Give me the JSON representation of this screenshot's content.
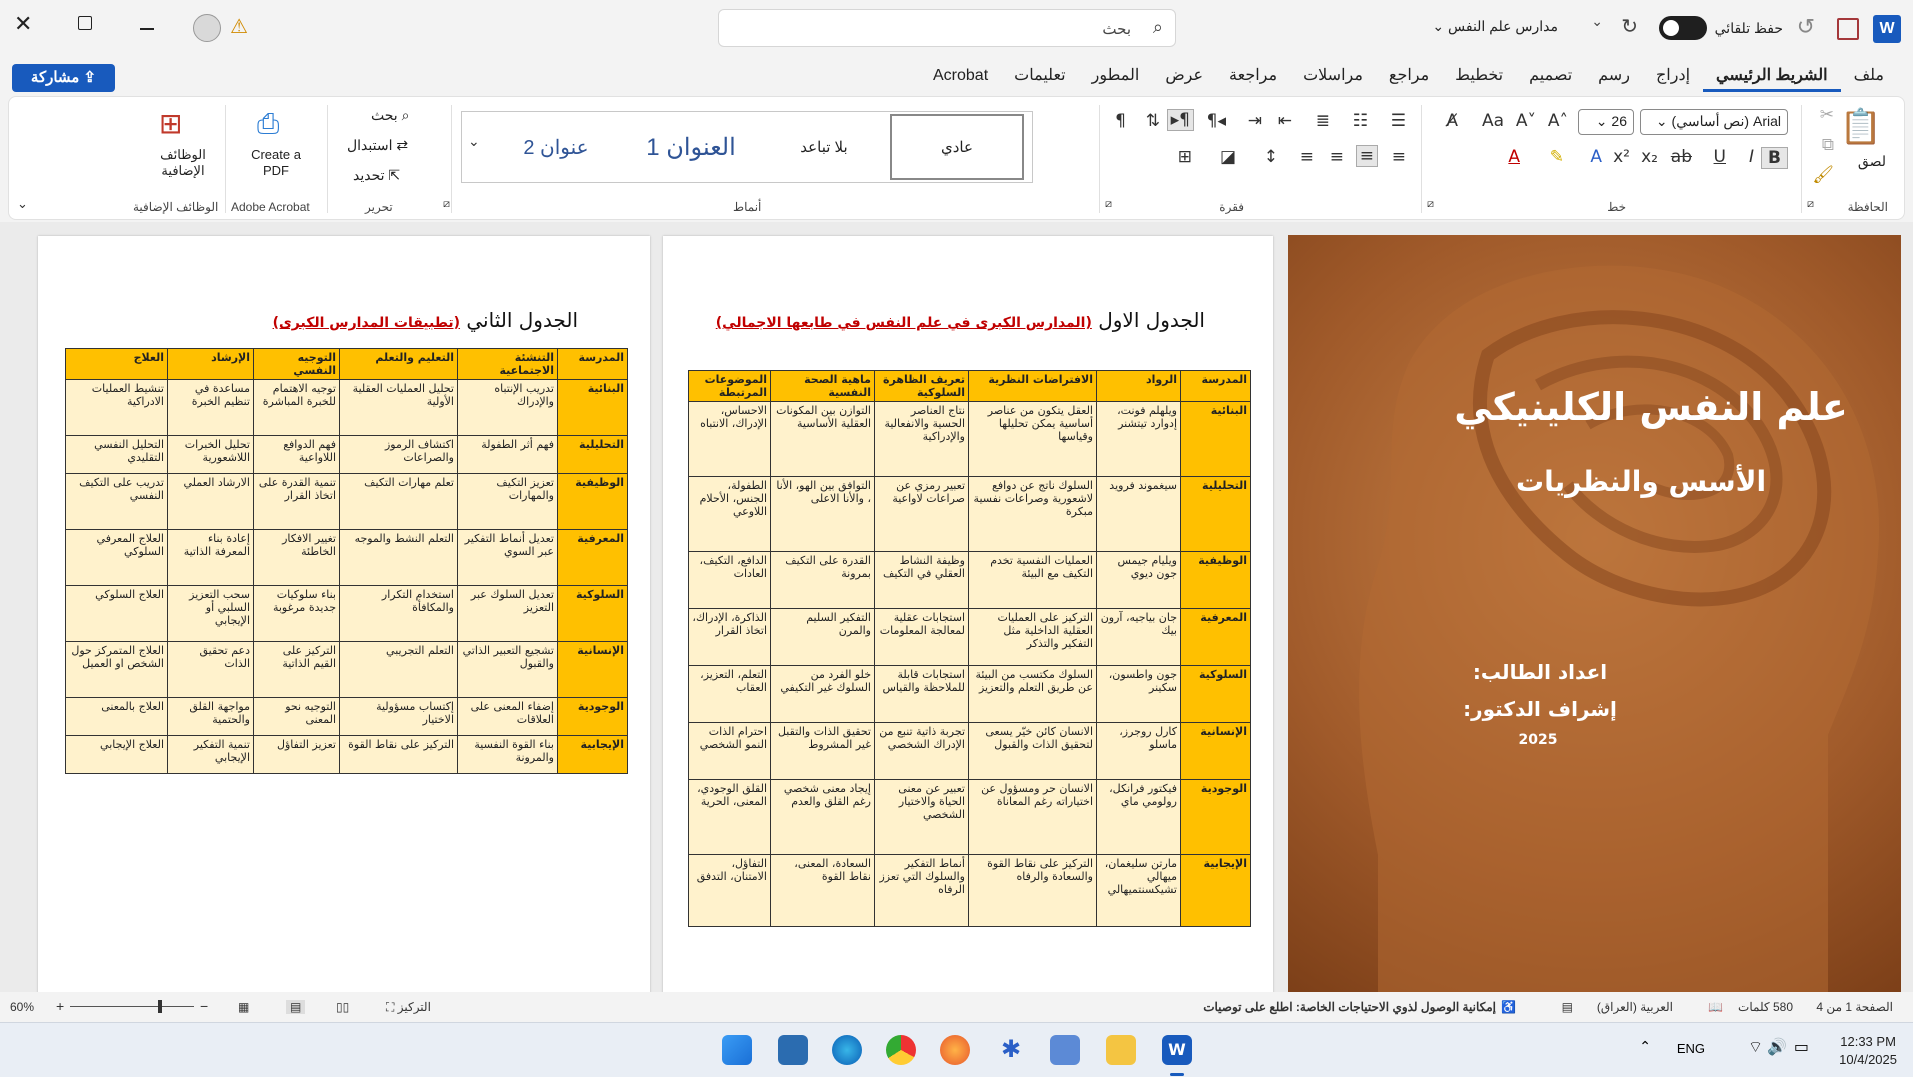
{
  "titlebar": {
    "doc_name": "مدارس علم النفس",
    "autosave_label": "حفظ تلقائي",
    "search_placeholder": "بحث",
    "word_icon": "W"
  },
  "menubar": {
    "share_label": "مشاركة",
    "tabs": [
      {
        "label": "ملف"
      },
      {
        "label": "الشريط الرئيسي"
      },
      {
        "label": "إدراج"
      },
      {
        "label": "رسم"
      },
      {
        "label": "تصميم"
      },
      {
        "label": "تخطيط"
      },
      {
        "label": "مراجع"
      },
      {
        "label": "مراسلات"
      },
      {
        "label": "مراجعة"
      },
      {
        "label": "عرض"
      },
      {
        "label": "المطور"
      },
      {
        "label": "تعليمات"
      },
      {
        "label": "Acrobat"
      }
    ]
  },
  "ribbon": {
    "clipboard": {
      "label": "الحافظة",
      "paste": "لصق"
    },
    "font": {
      "label": "خط",
      "font_name": "Arial (نص أساسي)",
      "font_size": "26"
    },
    "paragraph": {
      "label": "فقرة"
    },
    "styles": {
      "label": "أنماط",
      "items": [
        "عادي",
        "بلا تباعد",
        "العنوان 1",
        "عنوان 2"
      ]
    },
    "editing": {
      "label": "تحرير",
      "find": "بحث",
      "replace": "استبدال",
      "select": "تحديد"
    },
    "acrobat": {
      "label": "Adobe Acrobat",
      "create_pdf": "Create a PDF"
    },
    "addins": {
      "label": "الوظائف الإضافية",
      "btn": "الوظائف الإضافية"
    }
  },
  "cover": {
    "title": "علم النفس الكلينيكي",
    "subtitle": "الأسس والنظريات",
    "student": "اعداد الطالب:",
    "supervisor": "إشراف الدكتور:",
    "year": "2025"
  },
  "table1": {
    "caption": "الجدول الاول",
    "caption_red": "(المدارس الكبرى في علم النفس في طابعها الاجمالي)",
    "headers": [
      "المدرسة",
      "الرواد",
      "الافتراضات النظرية",
      "تعريف الظاهرة السلوكية",
      "ماهية الصحة النفسية",
      "الموضوعات المرتبطة"
    ],
    "rows": [
      [
        "البنائية",
        "ويلهلم فونت، إدوارد تيتشنر",
        "العقل يتكون من عناصر أساسية يمكن تحليلها وقياسها",
        "نتاج العناصر الحسية والانفعالية والإدراكية",
        "التوازن بين المكونات العقلية الأساسية",
        "الاحساس، الإدراك، الانتباه"
      ],
      [
        "التحليلية",
        "سيغموند فرويد",
        "السلوك ناتج عن دوافع لاشعورية وصراعات نفسية مبكرة",
        "تعبير رمزي عن صراعات لاواعية",
        "التوافق بين الهو، الأنا ، والأنا الاعلى",
        "الطفولة، الجنس، الأحلام اللاوعي"
      ],
      [
        "الوظيفية",
        "ويليام جيمس جون ديوي",
        "العمليات النفسية تخدم التكيف مع البيئة",
        "وظيفة النشاط العقلي في التكيف",
        "القدرة على التكيف بمرونة",
        "الدافع، التكيف، العادات"
      ],
      [
        "المعرفية",
        "جان بياجيه، آرون بيك",
        "التركيز على العمليات العقلية الداخلية مثل التفكير والتذكر",
        "استجابات عقلية لمعالجة المعلومات",
        "التفكير السليم والمرن",
        "الذاكرة، الإدراك، اتخاذ القرار"
      ],
      [
        "السلوكية",
        "جون واطسون، سكينر",
        "السلوك مكتسب من البيئة عن طريق التعلم والتعزيز",
        "استجابات قابلة للملاحظة والقياس",
        "خلو الفرد من السلوك غير التكيفي",
        "التعلم، التعزيز، العقاب"
      ],
      [
        "الإنسانية",
        "كارل روجرز، ماسلو",
        "الانسان كائن خيّر يسعى لتحقيق الذات والقبول",
        "تجربة ذاتية تنبع من الإدراك الشخصي",
        "تحقيق الذات والتقبل غير المشروط",
        "احترام الذات النمو الشخصي"
      ],
      [
        "الوجودية",
        "فيكتور فرانكل، رولومي ماي",
        "الانسان حر ومسؤول عن اختياراته رغم المعاناة",
        "تعبير عن معنى الحياة والاختيار الشخصي",
        "إيجاد معنى شخصي رغم القلق والعدم",
        "القلق الوجودي، المعنى، الحرية"
      ],
      [
        "الإيجابية",
        "مارتن سليغمان، ميهالي تشيكسنتميهالي",
        "التركيز على نقاط القوة والسعادة والرفاه",
        "أنماط التفكير والسلوك التي تعزز الرفاه",
        "السعادة، المعنى، نقاط القوة",
        "التفاؤل، الامتنان، التدفق"
      ]
    ]
  },
  "table2": {
    "caption": "الجدول الثاني",
    "caption_red": "(تطبيقات المدارس الكبرى)",
    "headers": [
      "المدرسة",
      "التنشئة الاجتماعية",
      "التعليم والتعلم",
      "التوجيه النفسي",
      "الإرشاد",
      "العلاج"
    ],
    "rows": [
      [
        "البنائية",
        "تدريب الإنتباه والإدراك",
        "تحليل العمليات العقلية الأولية",
        "توجيه الاهتمام للخبرة المباشرة",
        "مساعدة في تنظيم الخبرة",
        "تنشيط العمليات الادراكية"
      ],
      [
        "التحليلية",
        "فهم أثر الطفولة",
        "اكتشاف الرموز والصراعات",
        "فهم الدوافع اللاواعية",
        "تحليل الخبرات اللاشعورية",
        "التحليل النفسي التقليدي"
      ],
      [
        "الوظيفية",
        "تعزيز التكيف والمهارات",
        "تعلم مهارات التكيف",
        "تنمية القدرة على اتخاذ القرار",
        "الارشاد العملي",
        "تدريب على التكيف النفسي"
      ],
      [
        "المعرفية",
        "تعديل أنماط التفكير عبر السوي",
        "التعلم النشط والموجه",
        "تغيير الافكار الخاطئة",
        "إعادة بناء المعرفة الذاتية",
        "العلاج المعرفي السلوكي"
      ],
      [
        "السلوكية",
        "تعديل السلوك عبر التعزيز",
        "استخدام التكرار والمكافأة",
        "بناء سلوكيات جديدة مرغوبة",
        "سحب التعزيز السلبي أو الإيجابي",
        "العلاج السلوكي"
      ],
      [
        "الإنسانية",
        "تشجيع التعبير الذاتي والقبول",
        "التعلم التجريبي",
        "التركيز على القيم الذاتية",
        "دعم تحقيق الذات",
        "العلاج المتمركز حول الشخص او العميل"
      ],
      [
        "الوجودية",
        "إضفاء المعنى على العلاقات",
        "إكتساب مسؤولية الاختيار",
        "التوجيه نحو المعنى",
        "مواجهة القلق والحتمية",
        "العلاج بالمعنى"
      ],
      [
        "الإيجابية",
        "بناء القوة النفسية والمرونة",
        "التركيز على نقاط القوة",
        "تعزيز التفاؤل",
        "تنمية التفكير الإيجابي",
        "العلاج الإيجابي"
      ]
    ]
  },
  "statusbar": {
    "page": "الصفحة 1 من 4",
    "words": "580 كلمات",
    "language": "العربية (العراق)",
    "accessibility": "إمكانية الوصول لذوي الاحتياجات الخاصة: اطلع على توصيات",
    "focus": "التركيز",
    "zoom": "60%"
  },
  "taskbar": {
    "lang": "ENG",
    "time": "12:33 PM",
    "date": "10/4/2025"
  }
}
